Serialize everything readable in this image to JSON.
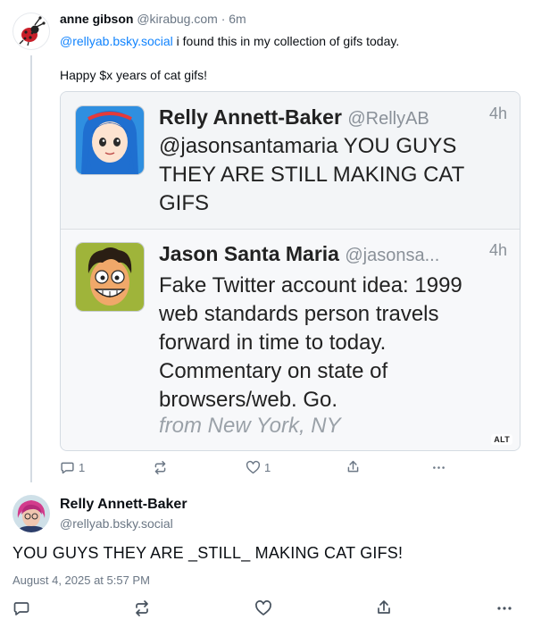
{
  "post1": {
    "author_name": "anne gibson",
    "author_handle": "@kirabug.com",
    "separator": "·",
    "time": "6m",
    "mention": "@rellyab.bsky.social",
    "text_after_mention": " i found this in my collection of gifs today.",
    "text_second_line": "Happy $x years of cat gifs!",
    "embed": {
      "tweet1": {
        "name": "Relly Annett-Baker",
        "handle": "@RellyAB",
        "time": "4h",
        "text": "@jasonsantamaria YOU GUYS THEY ARE STILL MAKING CAT GIFS"
      },
      "tweet2": {
        "name": "Jason Santa Maria",
        "handle": "@jasonsa...",
        "time": "4h",
        "text": "Fake Twitter account idea: 1999 web standards person travels forward in time to today. Commentary on state of browsers/web. Go.",
        "from": "from New York, NY"
      },
      "alt_badge": "ALT"
    },
    "actions": {
      "reply_count": "1",
      "repost_count": "",
      "like_count": "1"
    }
  },
  "post2": {
    "author_name": "Relly Annett-Baker",
    "author_handle": "@rellyab.bsky.social",
    "text": "YOU GUYS THEY ARE _STILL_ MAKING CAT GIFS!",
    "date": "August 4, 2025 at 5:57 PM"
  },
  "colors": {
    "mention": "#1083fe",
    "muted": "#6b7785",
    "thread_line": "#d4dbe2"
  },
  "icons": [
    "ladybug-avatar",
    "reply-icon",
    "repost-icon",
    "like-icon",
    "share-icon",
    "more-icon"
  ]
}
